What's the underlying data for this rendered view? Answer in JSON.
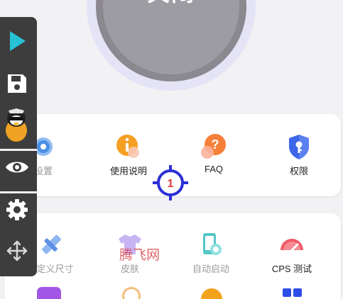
{
  "power": {
    "label": "关闭"
  },
  "top_card": {
    "items": [
      {
        "label": "设置",
        "icon": "gear-icon"
      },
      {
        "label": "使用说明",
        "icon": "info-icon"
      },
      {
        "label": "FAQ",
        "icon": "question-icon"
      },
      {
        "label": "权限",
        "icon": "shield-key-icon"
      }
    ]
  },
  "bottom_card": {
    "items": [
      {
        "label": "自定义尺寸",
        "icon": "ruler-pencil-icon"
      },
      {
        "label": "皮肤",
        "icon": "tshirt-icon"
      },
      {
        "label": "自动启动",
        "icon": "phone-auto-icon"
      },
      {
        "label": "CPS 测试",
        "icon": "speedometer-icon"
      }
    ]
  },
  "crosshair": {
    "number": "1"
  },
  "watermark": {
    "text": "腾飞网"
  },
  "colors": {
    "accent_cyan": "#27c2d6",
    "crosshair_blue": "#2b2fd6",
    "toolbar_bg": "#3d3d3d",
    "power_fill": "#9e9ca3"
  }
}
